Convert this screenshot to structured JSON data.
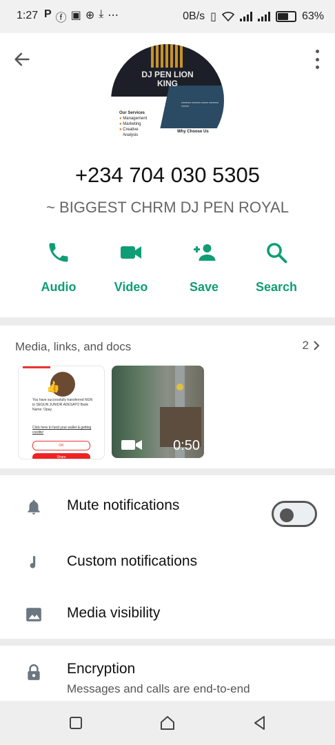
{
  "status_bar": {
    "time": "1:27",
    "notif_icons": [
      "P",
      "ⓕ",
      "▣",
      "⊕",
      "⤓",
      "⋯"
    ],
    "net_speed": "0B/s",
    "battery": "63%"
  },
  "contact": {
    "phone": "+234 704 030 5305",
    "about": "~ BIGGEST CHRM DJ PEN ROYAL",
    "avatar": {
      "title_line1": "DJ PEN LION",
      "title_line2": "KING",
      "services_heading": "Our Services",
      "services": [
        "Management",
        "Marketing",
        "Creative",
        "Analysis"
      ],
      "why": "Why Choose Us"
    }
  },
  "actions": [
    {
      "label": "Audio",
      "icon": "phone-icon"
    },
    {
      "label": "Video",
      "icon": "videocam-icon"
    },
    {
      "label": "Save",
      "icon": "add-person-icon"
    },
    {
      "label": "Search",
      "icon": "search-icon"
    }
  ],
  "media": {
    "title": "Media, links, and docs",
    "count": "2",
    "items": [
      {
        "type": "image",
        "text": "You have successfully transferred NGN to SEGUN JUNIOR ADESAYO Bank Name: Opay",
        "link_text": "Click here to fund your wallet & getting credits!",
        "ok_label": "OK",
        "share_label": "Share"
      },
      {
        "type": "video",
        "duration": "0:50"
      }
    ]
  },
  "settings": [
    {
      "label": "Mute notifications",
      "icon": "bell-icon",
      "toggle": false
    },
    {
      "label": "Custom notifications",
      "icon": "music-note-icon"
    },
    {
      "label": "Media visibility",
      "icon": "image-icon"
    }
  ],
  "encryption": {
    "label": "Encryption",
    "subtitle": "Messages and calls are end-to-end"
  },
  "colors": {
    "accent": "#0f9d76",
    "background": "#ececec"
  }
}
